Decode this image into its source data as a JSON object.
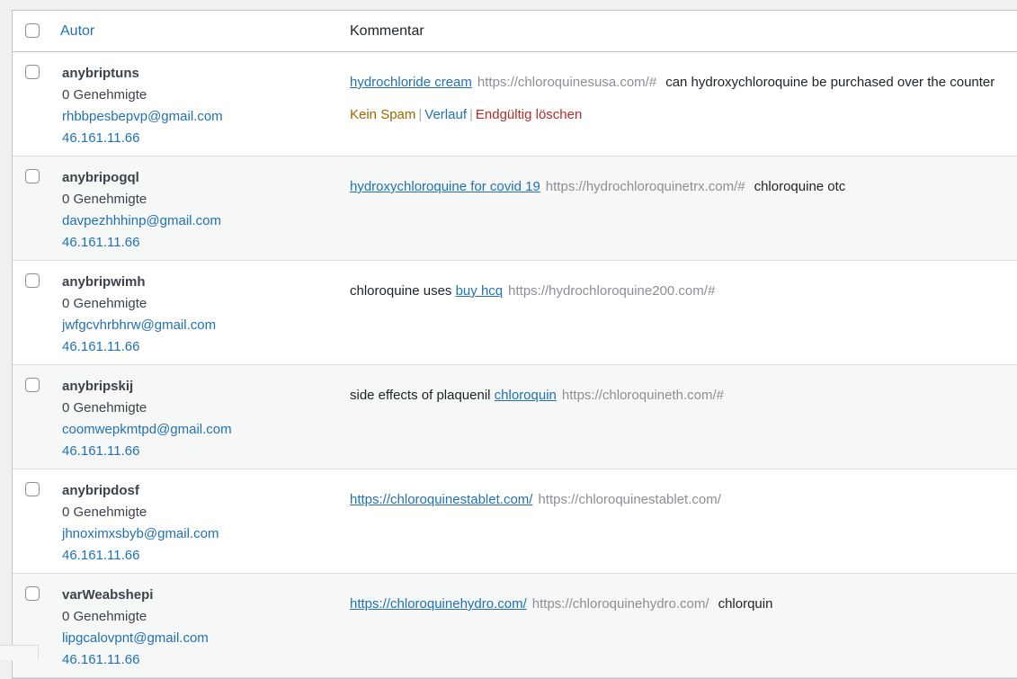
{
  "header": {
    "author_label": "Autor",
    "comment_label": "Kommentar"
  },
  "rows": [
    {
      "name": "anybriptuns",
      "approved": "0 Genehmigte",
      "email": "rhbbpesbepvp@gmail.com",
      "ip": "46.161.11.66",
      "pre": "",
      "link": "hydrochloride cream",
      "url": "https://chloroquinesusa.com/#",
      "text": "can hydroxychloroquine be purchased over the counter",
      "actions": {
        "not_spam": "Kein Spam",
        "history": "Verlauf",
        "delete": "Endgültig löschen"
      }
    },
    {
      "name": "anybripogql",
      "approved": "0 Genehmigte",
      "email": "davpezhhhinp@gmail.com",
      "ip": "46.161.11.66",
      "pre": "",
      "link": "hydroxychloroquine for covid 19",
      "url": "https://hydrochloroquinetrx.com/#",
      "text": "chloroquine otc"
    },
    {
      "name": "anybripwimh",
      "approved": "0 Genehmigte",
      "email": "jwfgcvhrbhrw@gmail.com",
      "ip": "46.161.11.66",
      "pre": "chloroquine uses",
      "link": "buy hcq",
      "url": "https://hydrochloroquine200.com/#",
      "text": ""
    },
    {
      "name": "anybripskij",
      "approved": "0 Genehmigte",
      "email": "coomwepkmtpd@gmail.com",
      "ip": "46.161.11.66",
      "pre": "side effects of plaquenil",
      "link": "chloroquin",
      "url": "https://chloroquineth.com/#",
      "text": ""
    },
    {
      "name": "anybripdosf",
      "approved": "0 Genehmigte",
      "email": "jhnoximxsbyb@gmail.com",
      "ip": "46.161.11.66",
      "pre": "",
      "link": "https://chloroquinestablet.com/",
      "url": "https://chloroquinestablet.com/",
      "text": ""
    },
    {
      "name": "varWeabshepi",
      "approved": "0 Genehmigte",
      "email": "lipgcalovpnt@gmail.com",
      "ip": "46.161.11.66",
      "pre": "",
      "link": "https://chloroquinehydro.com/",
      "url": "https://chloroquinehydro.com/",
      "text": "chlorquin"
    }
  ]
}
